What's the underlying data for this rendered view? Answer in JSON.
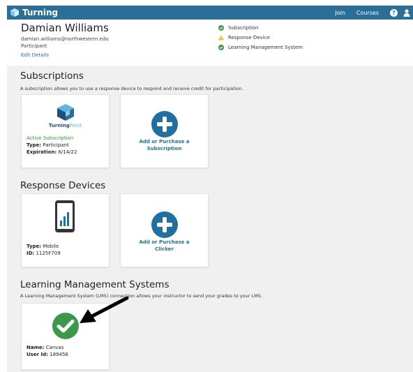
{
  "topbar": {
    "brand": "Turning",
    "join_label": "Join",
    "courses_label": "Courses",
    "help_glyph": "?"
  },
  "profile": {
    "name": "Damian Williams",
    "email": "damian.williams@northwestern.edu",
    "role": "Participant",
    "edit_label": "Edit Details"
  },
  "status": [
    {
      "label": "Subscription",
      "state": "ok"
    },
    {
      "label": "Response Device",
      "state": "warning"
    },
    {
      "label": "Learning Management System",
      "state": "ok"
    }
  ],
  "subscriptions": {
    "title": "Subscriptions",
    "desc": "A subscription allows you to use a response device to respond and receive credit for participation.",
    "card": {
      "logo_turning": "Turning",
      "logo_point": "Point",
      "status": "Active Subscription",
      "type_label": "Type:",
      "type_value": " Participant",
      "exp_label": "Expiration:",
      "exp_value": " 6/14/22"
    },
    "add_line1": "Add or Purchase a",
    "add_line2": "Subscription"
  },
  "devices": {
    "title": "Response Devices",
    "card": {
      "type_label": "Type:",
      "type_value": " Mobile",
      "id_label": "ID:",
      "id_value": " 1125F709"
    },
    "add_line1": "Add or Purchase a",
    "add_line2": "Clicker"
  },
  "lms": {
    "title": "Learning Management Systems",
    "desc": "A Learning Management System (LMS) connection allows your instructor to send your grades to your LMS.",
    "card": {
      "name_label": "Name:",
      "name_value": " Canvas",
      "user_label": "User Id:",
      "user_value": " 189456"
    }
  },
  "colors": {
    "topbar": "#2a6f97",
    "accent": "#1f6fa3",
    "success": "#3a9a4a",
    "warning": "#f2b51c",
    "active": "#2e9a3a"
  }
}
